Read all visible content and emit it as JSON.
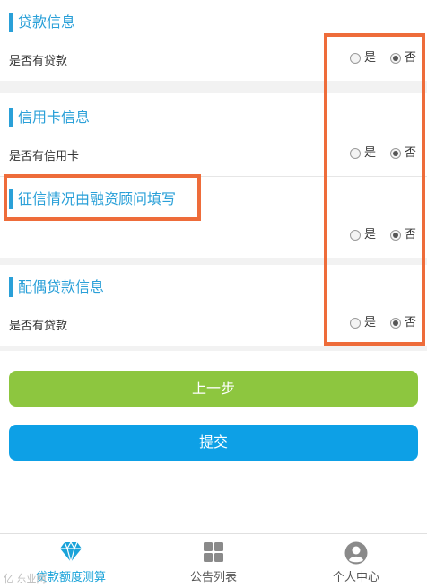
{
  "sections": {
    "loan": {
      "title": "贷款信息",
      "question": "是否有贷款"
    },
    "credit_card": {
      "title": "信用卡信息",
      "question": "是否有信用卡"
    },
    "credit_report": {
      "title": "征信情况由融资顾问填写"
    },
    "spouse_loan": {
      "title": "配偶贷款信息",
      "question": "是否有贷款"
    }
  },
  "radio": {
    "yes": "是",
    "no": "否",
    "selected": "否"
  },
  "buttons": {
    "prev": "上一步",
    "submit": "提交"
  },
  "tabbar": {
    "tabs": [
      {
        "label": "贷款额度测算",
        "icon": "diamond-icon",
        "active": true
      },
      {
        "label": "公告列表",
        "icon": "grid-icon",
        "active": false
      },
      {
        "label": "个人中心",
        "icon": "user-icon",
        "active": false
      }
    ]
  },
  "watermark": "亿 东业网",
  "colors": {
    "accent": "#2aa0d8",
    "highlight": "#ee6c3a",
    "prev_button": "#8dc63f",
    "submit_button": "#0da0e6"
  }
}
